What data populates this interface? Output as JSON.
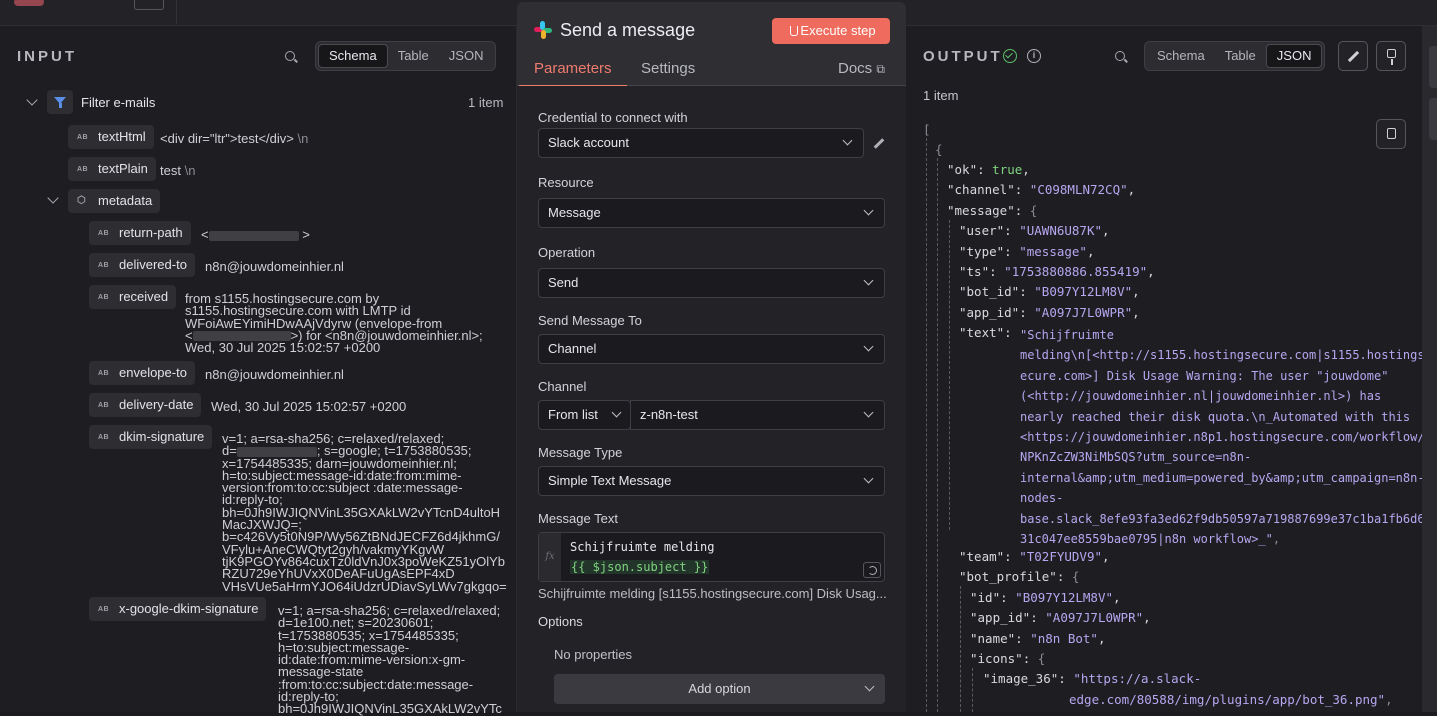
{
  "input": {
    "title": "INPUT",
    "views": [
      "Schema",
      "Table",
      "JSON"
    ],
    "node_name": "Filter e-mails",
    "item_count": "1 item",
    "fields": {
      "textHtml": {
        "key": "textHtml",
        "value": "<div dir=\"ltr\">test</div>",
        "suffix": "\\n"
      },
      "textPlain": {
        "key": "textPlain",
        "value": "test",
        "suffix": "\\n"
      },
      "metadata": {
        "key": "metadata"
      },
      "return_path": {
        "key": "return-path",
        "value_start": "<",
        "value_end": ">"
      },
      "delivered_to": {
        "key": "delivered-to",
        "value": "n8n@jouwdomeinhier.nl"
      },
      "received": {
        "key": "received",
        "lines": [
          "from s1155.hostingsecure.com by",
          "s1155.hostingsecure.com with LMTP id",
          "WFoiAwEYimiHDwAAjVdyrw (envelope-from",
          ">) for <n8n@jouwdomeinhier.nl>;",
          "Wed, 30 Jul 2025 15:02:57 +0200"
        ],
        "line4_start": "<"
      },
      "envelope_to": {
        "key": "envelope-to",
        "value": "n8n@jouwdomeinhier.nl"
      },
      "delivery_date": {
        "key": "delivery-date",
        "value": "Wed, 30 Jul 2025 15:02:57 +0200"
      },
      "dkim_signature": {
        "key": "dkim-signature",
        "lines": [
          "v=1; a=rsa-sha256; c=relaxed/relaxed;",
          "; s=google; t=1753880535;",
          "x=1754485335; darn=jouwdomeinhier.nl;",
          "h=to:subject:message-id:date:from:mime-",
          "version:from:to:cc:subject :date:message-",
          "id:reply-to;",
          "bh=0Jh9IWJIQNVinL35GXAkLW2vYTcnD4ultoH",
          "MacJXWJQ=;",
          "b=c426Vy5t0N9P/Wy56ZtBNdJECFZ6d4jkhmG/",
          "VFylu+AneCWQtyt2gyh/vakmyYKgvW",
          "tjK9PGOYv864cuxTz0ldVnJ0x3poWeKZ51yOlYb",
          "RZU729eYhUVxX0DeAFuUgAsEPF4xD",
          "VHsVUe5aHrmYJO64iUdzrUDiavSyLWv7gkgqo="
        ],
        "line2_start": "d="
      },
      "x_google_dkim": {
        "key": "x-google-dkim-signature",
        "lines": [
          "v=1; a=rsa-sha256; c=relaxed/relaxed;",
          "d=1e100.net; s=20230601;",
          "t=1753880535; x=1754485335;",
          "h=to:subject:message-",
          "id:date:from:mime-version:x-gm-",
          "message-state",
          ":from:to:cc:subject:date:message-",
          "id:reply-to;",
          "bh=0Jh9IWJIQNVinL35GXAkLW2vYTc"
        ]
      }
    }
  },
  "center": {
    "title": "Send a message",
    "execute_label": "Execute step",
    "tabs": {
      "parameters": "Parameters",
      "settings": "Settings",
      "docs": "Docs"
    },
    "credential": {
      "label": "Credential to connect with",
      "value": "Slack account"
    },
    "resource": {
      "label": "Resource",
      "value": "Message"
    },
    "operation": {
      "label": "Operation",
      "value": "Send"
    },
    "send_to": {
      "label": "Send Message To",
      "value": "Channel"
    },
    "channel": {
      "label": "Channel",
      "mode": "From list",
      "value": "z-n8n-test"
    },
    "message_type": {
      "label": "Message Type",
      "value": "Simple Text Message"
    },
    "message_text": {
      "label": "Message Text",
      "line1": "Schijfruimte melding",
      "line2": "{{ $json.subject }}",
      "fx": "fx",
      "preview": "Schijfruimte melding [s1155.hostingsecure.com] Disk Usag..."
    },
    "options": {
      "label": "Options",
      "empty": "No properties",
      "add": "Add option"
    },
    "colors": {
      "accent": "#ef6b5e"
    }
  },
  "output": {
    "title": "OUTPUT",
    "views": [
      "Schema",
      "Table",
      "JSON"
    ],
    "item_count": "1 item",
    "json": {
      "open_bracket": "[",
      "open_brace": "{",
      "ok_key": "\"ok\"",
      "ok_val": "true",
      "channel_key": "\"channel\"",
      "channel_val": "\"C098MLN72CQ\"",
      "message_key": "\"message\"",
      "user_key": "\"user\"",
      "user_val": "\"UAWN6U87K\"",
      "type_key": "\"type\"",
      "type_val": "\"message\"",
      "ts_key": "\"ts\"",
      "ts_val": "\"1753880886.855419\"",
      "bot_id_key": "\"bot_id\"",
      "bot_id_val": "\"B097Y12LM8V\"",
      "app_id_key": "\"app_id\"",
      "app_id_val": "\"A097J7L0WPR\"",
      "text_key": "\"text\"",
      "text_lines": [
        "\"Schijfruimte",
        "melding\\n[<http://s1155.hostingsecure.com|s1155.hostings",
        "ecure.com>] Disk Usage Warning: The user \"jouwdome\"",
        "(<http://jouwdomeinhier.nl|jouwdomeinhier.nl>) has",
        "nearly reached their disk quota.\\n_Automated with this",
        "<https://jouwdomeinhier.n8p1.hostingsecure.com/workflow/",
        "NPKnZcZW3NiMbSQS?utm_source=n8n-",
        "internal&amp;utm_medium=powered_by&amp;utm_campaign=n8n-",
        "nodes-",
        "base.slack_8efe93fa3ed62f9db50597a719887699e37c1ba1fb6d6",
        "31c047ee8559bae0795|n8n workflow>_\""
      ],
      "team_key": "\"team\"",
      "team_val": "\"T02FYUDV9\"",
      "bot_profile_key": "\"bot_profile\"",
      "id_key": "\"id\"",
      "id_val": "\"B097Y12LM8V\"",
      "app_id2_key": "\"app_id\"",
      "app_id2_val": "\"A097J7L0WPR\"",
      "name_key": "\"name\"",
      "name_val": "\"n8n Bot\"",
      "icons_key": "\"icons\"",
      "image36_key": "\"image_36\"",
      "image36_line1": "\"https://a.slack-",
      "image36_line2": "edge.com/80588/img/plugins/app/bot_36.png\""
    }
  }
}
